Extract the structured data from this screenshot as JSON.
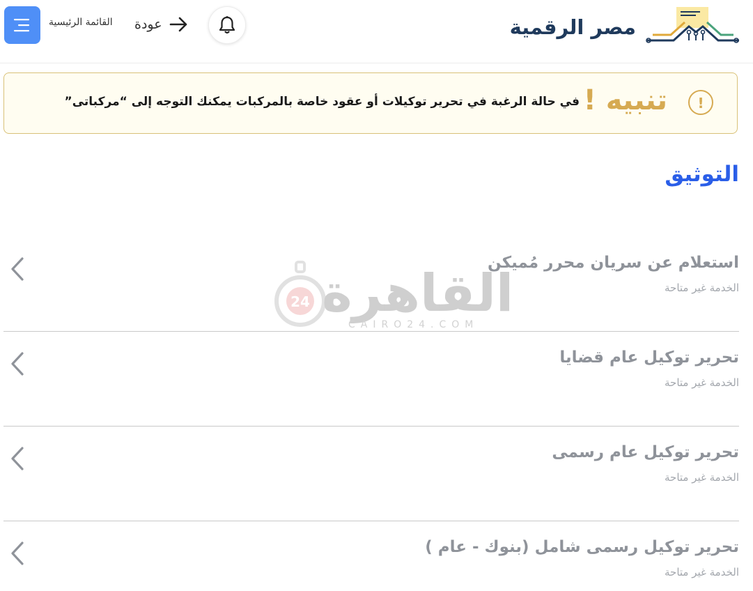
{
  "header": {
    "logo_text": "مصر الرقمية",
    "home_label": "القائمة الرئيسية",
    "back_label": "عودة",
    "icons": {
      "menu": "menu-icon",
      "back": "arrow-right-icon",
      "bell": "bell-icon"
    }
  },
  "alert": {
    "title": "تنبيه !",
    "message": "في حالة الرغبة في تحرير توكيلات أو عقود خاصة بالمركبات يمكنك التوجه إلى “مركباتى”",
    "icon": "exclamation-circle-icon"
  },
  "section": {
    "title": "التوثيق"
  },
  "services": [
    {
      "title": "استعلام عن سريان محرر مُميكن",
      "status": "الخدمة غير متاحة"
    },
    {
      "title": "تحرير توكيل عام قضايا",
      "status": "الخدمة غير متاحة"
    },
    {
      "title": "تحرير توكيل عام رسمى",
      "status": "الخدمة غير متاحة"
    },
    {
      "title": "تحرير توكيل رسمى شامل (بنوك - عام )",
      "status": "الخدمة غير متاحة"
    }
  ],
  "watermark": {
    "text": "القاهرة",
    "sub": "CAIRO24.COM",
    "badge": "24"
  },
  "colors": {
    "accent": "#2a5ee8",
    "menu_button": "#4f8ff7",
    "alert_gold": "#d6aa52",
    "alert_bg": "#fffdf1",
    "muted_text": "#8f939a"
  }
}
